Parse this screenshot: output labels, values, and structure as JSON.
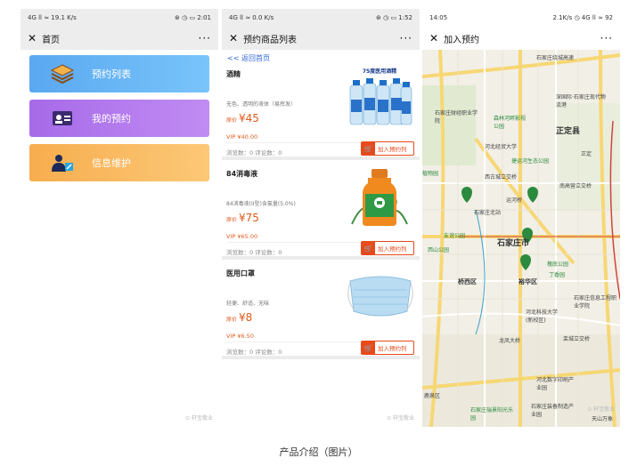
{
  "caption": "产品介绍（图片）",
  "phone1": {
    "status": {
      "left": "4G ll ≈ 19.1 K/s",
      "right": "⊛ ◷ ▭ 2:01"
    },
    "title": "首页",
    "more": "···",
    "menu": [
      {
        "label": "预约列表",
        "icon": "layers-icon"
      },
      {
        "label": "我的预约",
        "icon": "id-card-icon"
      },
      {
        "label": "信息维护",
        "icon": "user-edit-icon"
      }
    ],
    "watermark": "⊙ 轩宝敬业"
  },
  "phone2": {
    "status": {
      "left": "4G ll ≈ 0.0 K/s",
      "right": "⊛ ◷ ▭ 1:52"
    },
    "title": "预约商品列表",
    "more": "···",
    "back_link": "<< 返回首页",
    "products": [
      {
        "name": "酒精",
        "desc": "无色、透明的液体（易挥发）",
        "price_label": "原价",
        "price": "¥45",
        "vip": "VIP ¥40.00",
        "stats": "浏览数：0   评论数：0",
        "button": "加入预约列",
        "img_text": "75度医用酒精"
      },
      {
        "name": "84消毒液",
        "desc": "84消毒液(II型)含氯量(5.0%)",
        "price_label": "原价",
        "price": "¥75",
        "vip": "VIP ¥65.00",
        "stats": "浏览数：0   评论数：0",
        "button": "加入预约列"
      },
      {
        "name": "医用口罩",
        "desc": "轻便、舒适、无味",
        "price_label": "原价",
        "price": "¥8",
        "vip": "VIP ¥6.50",
        "stats": "浏览数：0   评论数：0",
        "button": "加入预约列"
      }
    ],
    "watermark": "⊙ 轩宝敬业"
  },
  "phone3": {
    "status": {
      "left": "14:05",
      "right": "2.1K/s ◷ 4G ll ≈ 92"
    },
    "title": "加入预约",
    "more": "···",
    "map_labels": {
      "highway_ne": "石家庄绕城高速",
      "ningxiang": "深国际·石家庄现代物流港",
      "zhengding": "正定县",
      "zhengding2": "正定",
      "college": "石家庄财经职业学院",
      "park1": "森林河畔影视公园",
      "hebei_sci": "河北经贸大学",
      "tangyin": "捷运河生态公园",
      "zhiwuyuan": "植物园",
      "xibei": "西古城立交桥",
      "nangao": "南高营立交桥",
      "station_n": "石家庄北站",
      "yuanhe": "运河桥",
      "youyi": "友谊公园",
      "city": "石家庄市",
      "zoo": "西山公园",
      "qiao_xi": "桥西区",
      "yuhua": "裕华区",
      "yuqiao": "槐底公园",
      "dingdian": "丁香园",
      "infotech": "石家庄信息工程职业学院",
      "kexue": "河北科技大学(新校区)",
      "luancheng": "栾城立交桥",
      "longquan": "龙凤大桥",
      "shuzi": "河北数字印刷产业园",
      "zhuangbei": "石家庄装备制造产业园",
      "ruijing": "石家庄瑞景阳光乐园",
      "tianshan": "天山万象",
      "lucheng": "鹿泉区"
    },
    "watermark": "⊙ 轩宝敬业"
  },
  "colors": {
    "blue": "#5aa8f0",
    "purple": "#a66ae8",
    "orange": "#f7ad4e",
    "price": "#e05a1b",
    "button": "#e84a1a",
    "link": "#2f63d6",
    "map_road": "#f7d774",
    "map_green": "#2b8a3e"
  }
}
